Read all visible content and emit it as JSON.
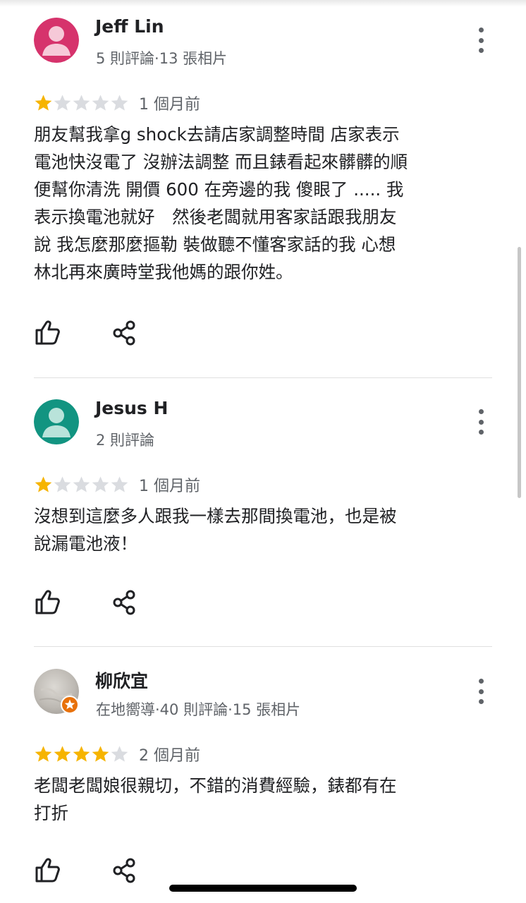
{
  "colors": {
    "star_filled": "#f6b400",
    "star_empty": "#dadce0",
    "text_primary": "#202124",
    "text_secondary": "#5f6368",
    "avatar_jeff": "#d6336c",
    "avatar_jesus": "#129481"
  },
  "reviews": [
    {
      "name": "Jeff Lin",
      "meta": "5 則評論·13 張相片",
      "rating": 1,
      "time": "1 個月前",
      "text": "朋友幫我拿g shock去請店家調整時間 店家表示\n電池快沒電了 沒辦法調整 而且錶看起來髒髒的順\n便幫你清洗 開價 600 在旁邊的我 傻眼了 ..... 我\n表示換電池就好　然後老闆就用客家話跟我朋友\n說 我怎麼那麼摳勒  裝做聽不懂客家話的我 心想\n林北再來廣時堂我他媽的跟你姓。",
      "avatar_icon": "person-icon"
    },
    {
      "name": "Jesus H",
      "meta": "2 則評論",
      "rating": 1,
      "time": "1 個月前",
      "text": "沒想到這麼多人跟我一樣去那間換電池，也是被\n說漏電池液！",
      "avatar_icon": "person-icon"
    },
    {
      "name": "柳欣宜",
      "meta": "在地嚮導·40 則評論·15 張相片",
      "rating": 4,
      "time": "2 個月前",
      "text": "老闆老闆娘很親切，不錯的消費經驗，錶都有在\n打折",
      "avatar_icon": "photo-avatar",
      "badge_icon": "local-guide-star-icon"
    }
  ]
}
